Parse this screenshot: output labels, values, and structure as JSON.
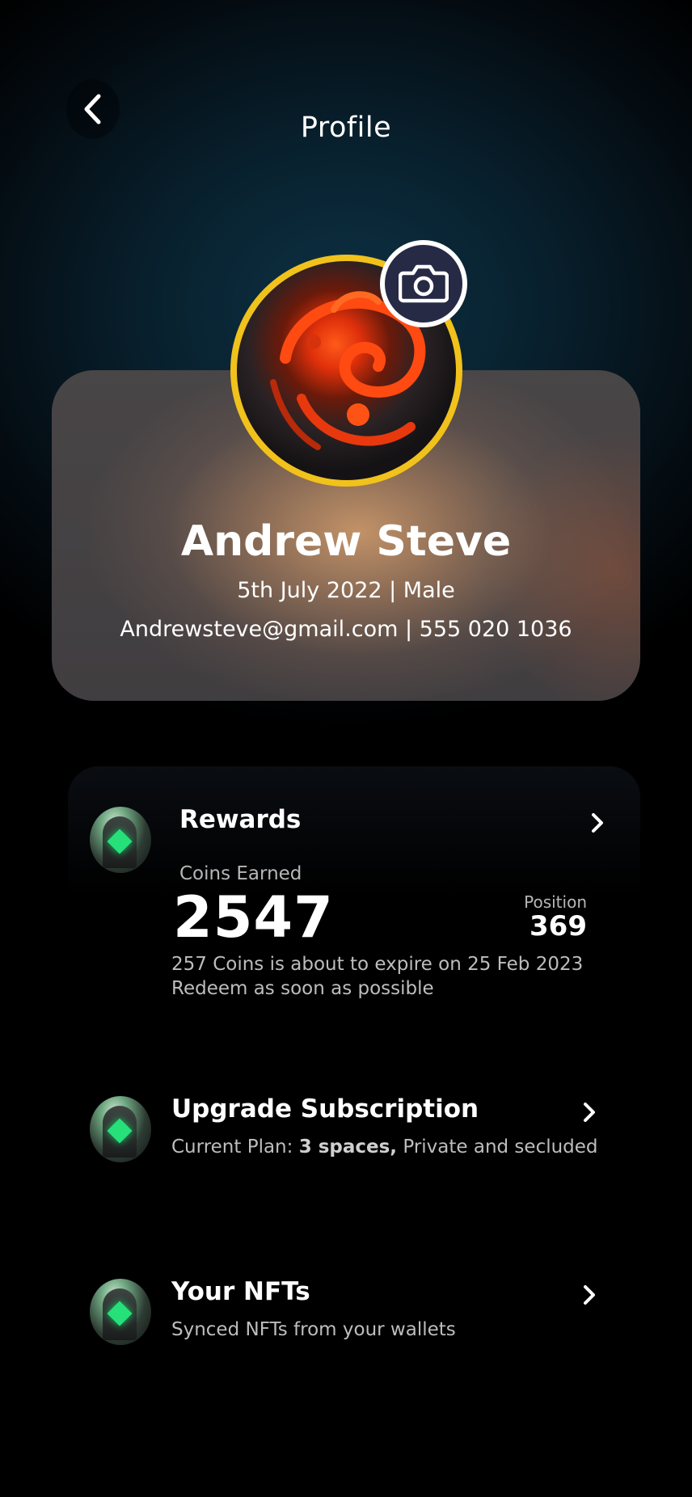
{
  "header": {
    "title": "Profile"
  },
  "profile": {
    "name": "Andrew Steve",
    "dob_gender": "5th July 2022 | Male",
    "contact": "Andrewsteve@gmail.com | 555 020 1036"
  },
  "rewards": {
    "title": "Rewards",
    "coins_label": "Coins Earned",
    "coins_value": "2547",
    "position_label": "Position",
    "position_value": "369",
    "expire_line1": "257 Coins is about to expire on 25 Feb 2023",
    "expire_line2": "Redeem as soon as possible"
  },
  "subscription": {
    "title": "Upgrade Subscription",
    "desc_prefix": "Current Plan: ",
    "desc_bold": "3 spaces,",
    "desc_suffix": " Private and secluded"
  },
  "nfts": {
    "title": "Your NFTs",
    "desc": "Synced NFTs from your wallets"
  },
  "colors": {
    "avatar_ring": "#f1c21b",
    "camera_bg": "#262a45",
    "gem": "#26e07a"
  },
  "icons": {
    "back": "chevron-left-icon",
    "camera": "camera-icon",
    "row_badge": "gem-badge-icon",
    "row_arrow": "chevron-right-icon"
  }
}
